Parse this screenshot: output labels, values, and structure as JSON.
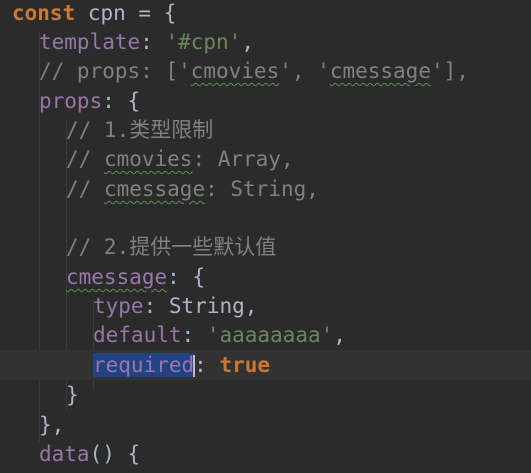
{
  "editor": {
    "lines": {
      "l1": {
        "kw": "const",
        "name": " cpn = {"
      },
      "l2": {
        "prop": "template",
        "colon": ": ",
        "str": "'#cpn'",
        "end": ","
      },
      "l3": {
        "pre": "// props: ['",
        "w1": "cmovies",
        "mid": "', '",
        "w2": "cmessage",
        "post": "'],"
      },
      "l4": {
        "prop": "props",
        "end": ": {"
      },
      "l5": {
        "cmt": "// 1.类型限制"
      },
      "l6": {
        "pre": "// ",
        "w": "cmovies",
        "post": ": Array,"
      },
      "l7": {
        "pre": "// ",
        "w": "cmessage",
        "post": ": String,"
      },
      "l9": {
        "cmt": "// 2.提供一些默认值"
      },
      "l10": {
        "prop": "cmessage",
        "end": ": {"
      },
      "l11": {
        "prop": "type",
        "colon": ": ",
        "val": "String",
        "end": ","
      },
      "l12": {
        "prop": "default",
        "colon": ": ",
        "str": "'aaaaaaaa'",
        "end": ","
      },
      "l13": {
        "sel": "required",
        "colon": ": ",
        "kw": "true"
      },
      "l14": {
        "brace": "}"
      },
      "l15": {
        "brace": "},"
      },
      "l16": {
        "prop": "data",
        "end": "() {"
      }
    }
  }
}
